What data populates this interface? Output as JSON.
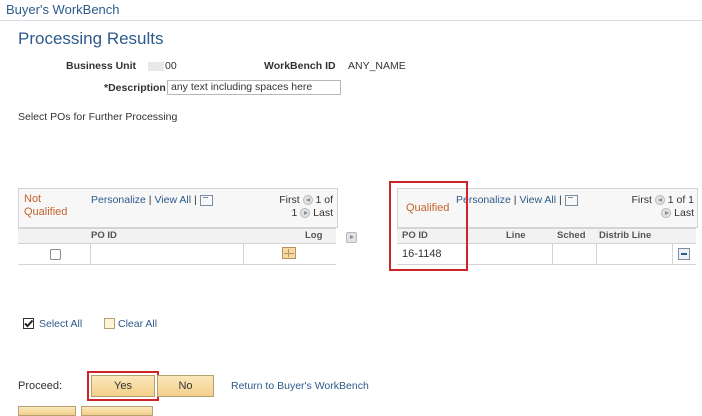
{
  "header": {
    "app_title": "Buyer's WorkBench"
  },
  "page": {
    "title": "Processing Results"
  },
  "form": {
    "business_unit_label": "Business Unit",
    "business_unit_value": "00",
    "workbench_id_label": "WorkBench ID",
    "workbench_id_value": "ANY_NAME",
    "description_label": "*Description",
    "description_value": "any text including spaces here"
  },
  "instructions": "Select POs for Further Processing",
  "not_qualified_grid": {
    "title_line1": "Not",
    "title_line2": "Qualified",
    "personalize": "Personalize",
    "sep": "|",
    "view_all": "View All",
    "nav_first": "First",
    "nav_count_a": "1 of",
    "nav_count_b": "1",
    "nav_last": "Last",
    "columns": [
      "PO ID",
      "Log"
    ]
  },
  "qualified_grid": {
    "title": "Qualified",
    "personalize": "Personalize",
    "sep": "|",
    "view_all": "View All",
    "nav_first": "First",
    "nav_count": "1 of 1",
    "nav_last": "Last",
    "columns": [
      "PO ID",
      "Line",
      "Sched",
      "Distrib Line"
    ],
    "rows": [
      {
        "po_id": "16-1148"
      }
    ]
  },
  "selection": {
    "select_all": "Select All",
    "clear_all": "Clear All"
  },
  "proceed": {
    "label": "Proceed:",
    "yes": "Yes",
    "no": "No",
    "return_link": "Return to Buyer's WorkBench"
  }
}
